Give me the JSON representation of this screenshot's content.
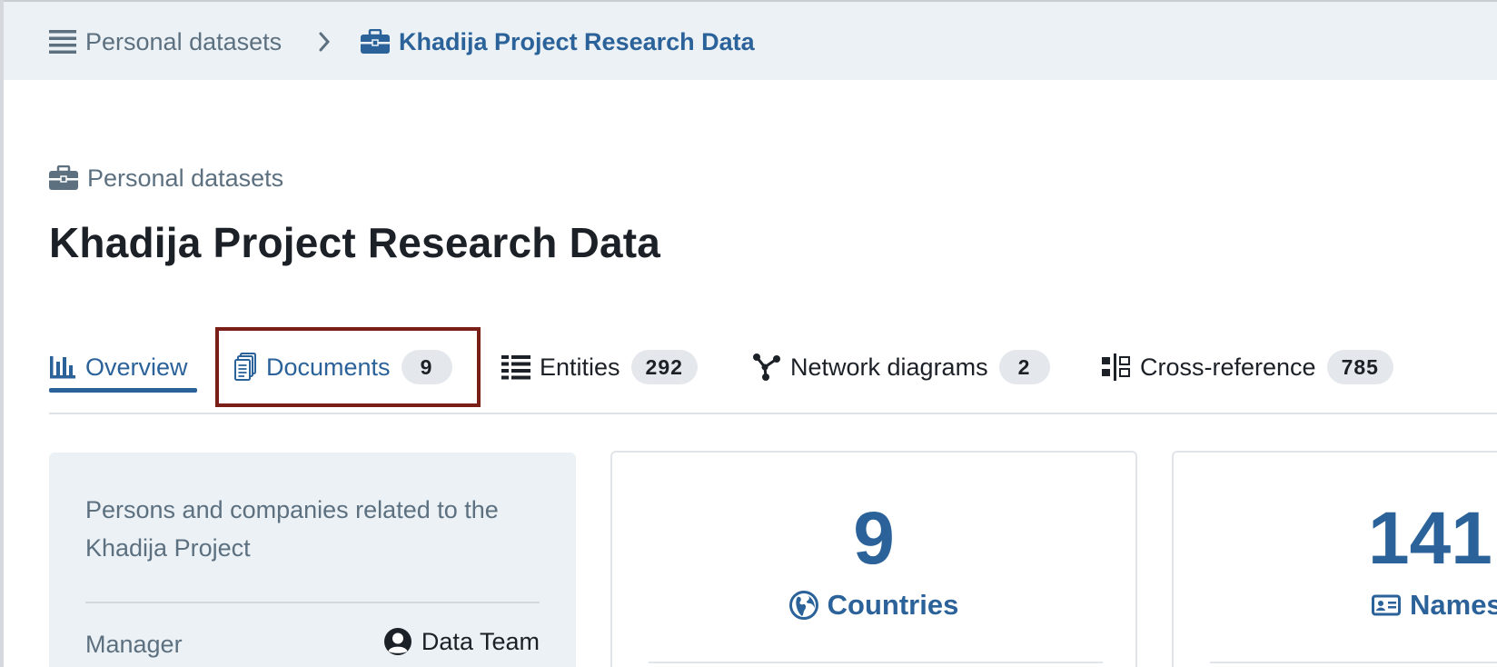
{
  "breadcrumb": {
    "root_label": "Personal datasets",
    "current_label": "Khadija Project Research Data"
  },
  "header": {
    "category_label": "Personal datasets",
    "title": "Khadija Project Research Data"
  },
  "tabs": [
    {
      "label": "Overview",
      "count": null,
      "active": true
    },
    {
      "label": "Documents",
      "count": "9"
    },
    {
      "label": "Entities",
      "count": "292"
    },
    {
      "label": "Network diagrams",
      "count": "2"
    },
    {
      "label": "Cross-reference",
      "count": "785"
    }
  ],
  "info": {
    "summary": "Persons and companies related to the Khadija Project",
    "manager_label": "Manager",
    "manager_value": "Data Team"
  },
  "stats": {
    "countries": {
      "value": "9",
      "label": "Countries"
    },
    "names": {
      "value": "141",
      "label": "Names"
    }
  },
  "colors": {
    "accent": "#2b6299",
    "topbar_bg": "#ebf1f5",
    "highlight_border": "#7a1f17"
  },
  "icons": {
    "menu": "hamburger-icon",
    "dataset": "briefcase-icon",
    "overview": "bar-chart-icon",
    "documents": "documents-icon",
    "entities": "list-icon",
    "network": "network-icon",
    "xref": "cross-reference-icon",
    "manager": "user-icon",
    "countries": "globe-icon",
    "names": "id-card-icon"
  }
}
